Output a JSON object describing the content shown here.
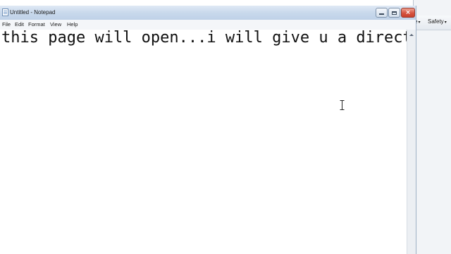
{
  "window": {
    "title": "Untitled - Notepad",
    "close_symbol": "×"
  },
  "menu": {
    "items": [
      "File",
      "Edit",
      "Format",
      "View",
      "Help"
    ]
  },
  "editor": {
    "text": "this page will open...i will give u a direct"
  },
  "background_window": {
    "toolbar": [
      {
        "label": "e",
        "caret": "▾"
      },
      {
        "label": "Safety",
        "caret": "▾"
      }
    ]
  },
  "colors": {
    "titlebar": "#c9d9ec",
    "close_button": "#d6533f",
    "editor_background": "#ffffff"
  }
}
